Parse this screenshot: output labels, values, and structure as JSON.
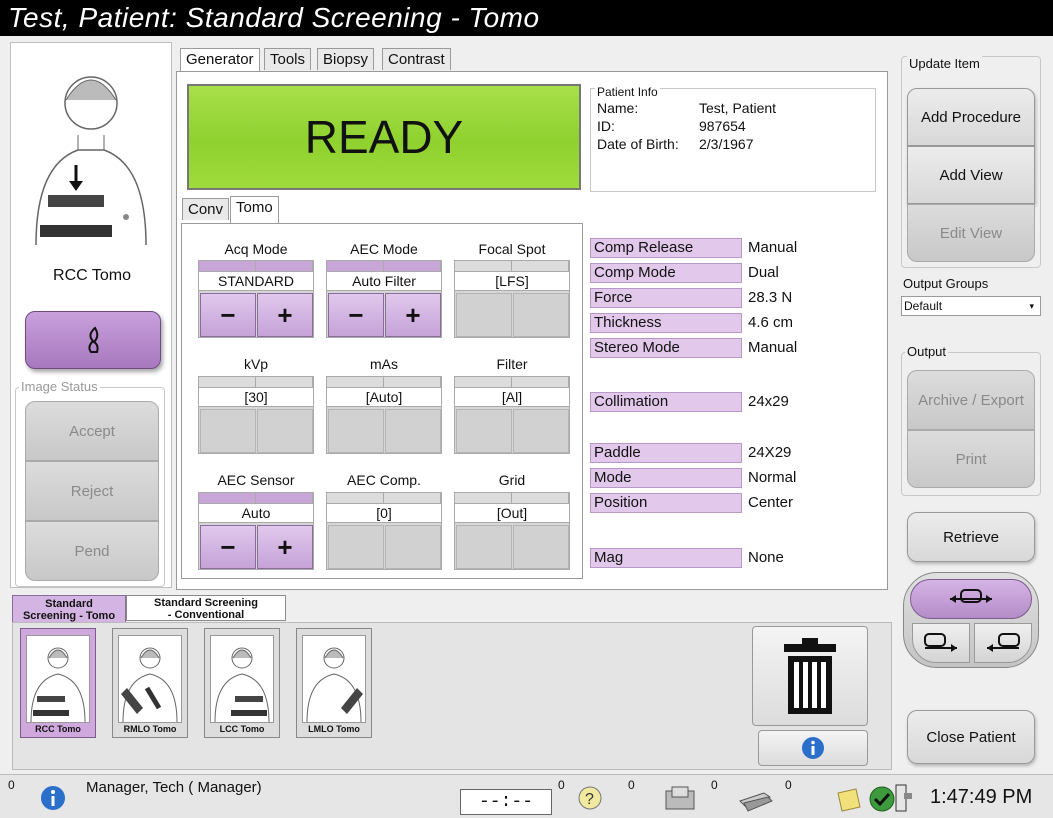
{
  "title": "Test, Patient:  Standard Screening - Tomo",
  "view_label": "RCC Tomo",
  "image_status": {
    "legend": "Image Status",
    "accept": "Accept",
    "reject": "Reject",
    "pend": "Pend"
  },
  "tabs": [
    "Generator",
    "Tools",
    "Biopsy",
    "Contrast"
  ],
  "ready": "READY",
  "patient": {
    "legend": "Patient Info",
    "name_label": "Name:",
    "name": "Test, Patient",
    "id_label": "ID:",
    "id": "987654",
    "dob_label": "Date of Birth:",
    "dob": "2/3/1967"
  },
  "subtabs": [
    "Conv",
    "Tomo"
  ],
  "controls": {
    "acq_mode": {
      "label": "Acq Mode",
      "value": "STANDARD"
    },
    "aec_mode": {
      "label": "AEC Mode",
      "value": "Auto Filter"
    },
    "focal_spot": {
      "label": "Focal Spot",
      "value": "[LFS]"
    },
    "kvp": {
      "label": "kVp",
      "value": "[30]"
    },
    "mas": {
      "label": "mAs",
      "value": "[Auto]"
    },
    "filter": {
      "label": "Filter",
      "value": "[Al]"
    },
    "aec_sensor": {
      "label": "AEC Sensor",
      "value": "Auto"
    },
    "aec_comp": {
      "label": "AEC Comp.",
      "value": "[0]"
    },
    "grid": {
      "label": "Grid",
      "value": "[Out]"
    },
    "minus": "−",
    "plus": "+"
  },
  "props": [
    {
      "name": "Comp Release",
      "value": "Manual"
    },
    {
      "name": "Comp Mode",
      "value": "Dual"
    },
    {
      "name": "Force",
      "value": "28.3 N"
    },
    {
      "name": "Thickness",
      "value": "4.6 cm"
    },
    {
      "name": "Stereo Mode",
      "value": "Manual"
    },
    {
      "name": "Collimation",
      "value": "24x29"
    },
    {
      "name": "Paddle",
      "value": "24X29"
    },
    {
      "name": "Mode",
      "value": "Normal"
    },
    {
      "name": "Position",
      "value": "Center"
    },
    {
      "name": "Mag",
      "value": "None"
    }
  ],
  "procedure_tabs": [
    {
      "line1": "Standard",
      "line2": "Screening - Tomo"
    },
    {
      "line1": "Standard Screening",
      "line2": "- Conventional"
    }
  ],
  "thumbnails": [
    "RCC Tomo",
    "RMLO Tomo",
    "LCC Tomo",
    "LMLO Tomo"
  ],
  "right": {
    "update_legend": "Update Item",
    "add_procedure": "Add Procedure",
    "add_view": "Add View",
    "edit_view": "Edit View",
    "output_groups_legend": "Output Groups",
    "output_groups_value": "Default",
    "output_legend": "Output",
    "archive": "Archive / Export",
    "print": "Print",
    "retrieve": "Retrieve",
    "close_patient": "Close Patient"
  },
  "status": {
    "count_info": "0",
    "user": "Manager, Tech ( Manager)",
    "timer": "--:--",
    "counts": [
      "0",
      "0",
      "0",
      "0"
    ],
    "time": "1:47:49 PM"
  },
  "colors": {
    "accent": "#b48cc8",
    "ready": "#9ad63a"
  }
}
